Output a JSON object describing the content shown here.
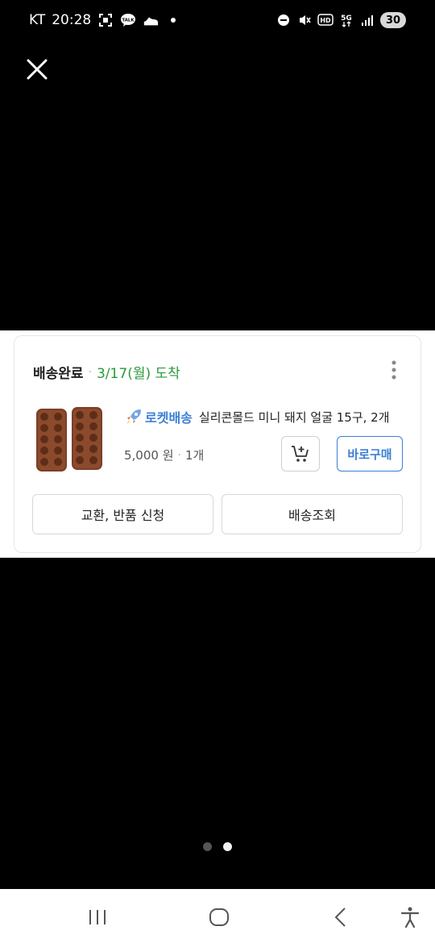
{
  "status_bar": {
    "carrier": "KT",
    "time": "20:28",
    "talk_badge": "TALK",
    "network": "5G",
    "hd_label": "HD",
    "battery": "30"
  },
  "order_card": {
    "status": "배송완료",
    "arrival": "3/17(월) 도착",
    "delivery_badge": "로켓배송",
    "product_name": "실리콘몰드 미니 돼지 얼굴 15구, 2개",
    "price": "5,000 원",
    "quantity": "1개",
    "buy_now_label": "바로구매",
    "exchange_return_label": "교환, 반품 신청",
    "track_delivery_label": "배송조회",
    "colors": {
      "status_green": "#2a9a3a",
      "accent_blue": "#3b7fd6"
    }
  },
  "pager": {
    "count": 2,
    "active_index": 2
  },
  "icons": {
    "close": "close-icon",
    "more": "more-vertical-icon",
    "cart": "add-to-cart-icon",
    "rocket": "rocket-icon",
    "nav_recents": "recent-apps-icon",
    "nav_home": "home-icon",
    "nav_back": "back-icon",
    "nav_accessibility": "accessibility-icon"
  }
}
